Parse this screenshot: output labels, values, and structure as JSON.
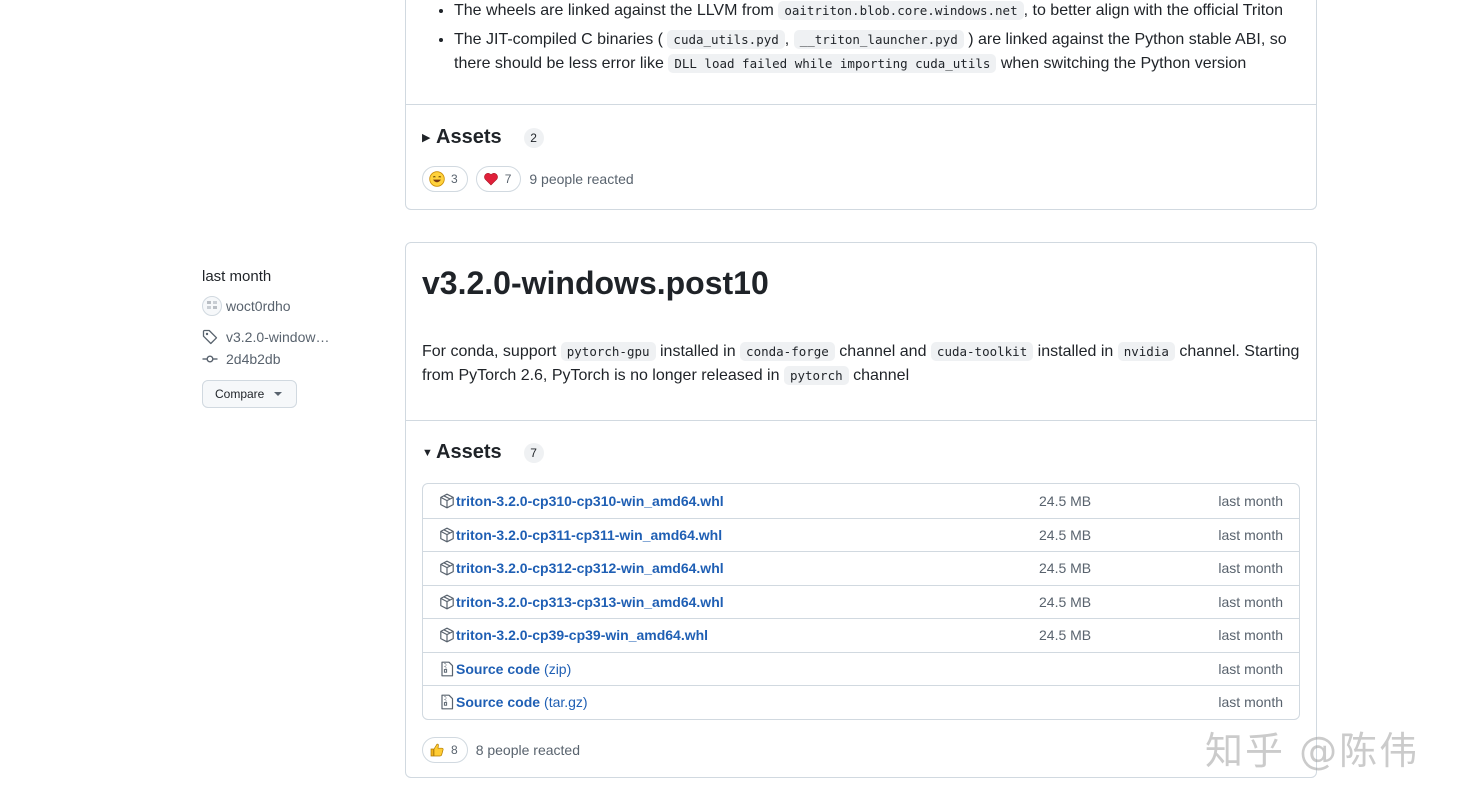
{
  "prev_release": {
    "bullets": [
      {
        "pre": "The wheels are linked against the LLVM from ",
        "code1": "oaitriton.blob.core.windows.net",
        "post": ", to better align with the official Triton"
      },
      {
        "pre": "The JIT-compiled C binaries (",
        "code1": "cuda_utils.pyd",
        "mid": ",",
        "code2": "__triton_launcher.pyd",
        "mid2": ") are linked against the Python stable ABI, so there should be less error like ",
        "code3": "DLL load failed while importing cuda_utils",
        "post": " when switching the Python version"
      }
    ],
    "assets_label": "Assets",
    "assets_count": "2",
    "reactions": [
      {
        "icon": "laugh-emoji-icon",
        "count": "3"
      },
      {
        "icon": "heart-emoji-icon",
        "count": "7"
      }
    ],
    "reactions_text": "9 people reacted"
  },
  "sidebar": {
    "date": "last month",
    "author": "woct0rdho",
    "tag": "v3.2.0-window…",
    "commit": "2d4b2db",
    "compare_label": "Compare"
  },
  "release": {
    "title": "v3.2.0-windows.post10",
    "body": {
      "t1": "For conda, support ",
      "c1": "pytorch-gpu",
      "t2": " installed in ",
      "c2": "conda-forge",
      "t3": " channel and ",
      "c3": "cuda-toolkit",
      "t4": " installed in ",
      "c4": "nvidia",
      "t5": " channel. Starting from PyTorch 2.6, PyTorch is no longer released in ",
      "c5": "pytorch",
      "t6": " channel"
    },
    "assets_label": "Assets",
    "assets_count": "7",
    "assets": [
      {
        "name": "triton-3.2.0-cp310-cp310-win_amd64.whl",
        "sub": "",
        "size": "24.5 MB",
        "date": "last month",
        "icon": "package-icon"
      },
      {
        "name": "triton-3.2.0-cp311-cp311-win_amd64.whl",
        "sub": "",
        "size": "24.5 MB",
        "date": "last month",
        "icon": "package-icon"
      },
      {
        "name": "triton-3.2.0-cp312-cp312-win_amd64.whl",
        "sub": "",
        "size": "24.5 MB",
        "date": "last month",
        "icon": "package-icon"
      },
      {
        "name": "triton-3.2.0-cp313-cp313-win_amd64.whl",
        "sub": "",
        "size": "24.5 MB",
        "date": "last month",
        "icon": "package-icon"
      },
      {
        "name": "triton-3.2.0-cp39-cp39-win_amd64.whl",
        "sub": "",
        "size": "24.5 MB",
        "date": "last month",
        "icon": "package-icon"
      },
      {
        "name": "Source code",
        "sub": "(zip)",
        "size": "",
        "date": "last month",
        "icon": "file-zip-icon"
      },
      {
        "name": "Source code",
        "sub": "(tar.gz)",
        "size": "",
        "date": "last month",
        "icon": "file-zip-icon"
      }
    ],
    "reactions": [
      {
        "icon": "thumbs-up-emoji-icon",
        "count": "8"
      }
    ],
    "reactions_text": "8 people reacted"
  },
  "watermark": "知乎 @陈伟"
}
